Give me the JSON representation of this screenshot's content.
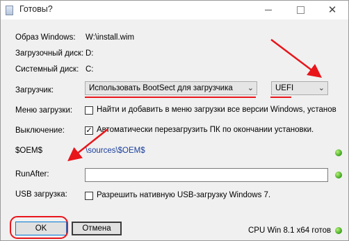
{
  "window": {
    "title": "Готовы?"
  },
  "titlebar": {
    "minimize": "—",
    "maximize": "☐",
    "close": "✕"
  },
  "fields": {
    "image_label": "Образ Windows:",
    "image_value": "W:\\install.wim",
    "boot_disk_label": "Загрузочный диск:",
    "boot_disk_value": "D:",
    "system_disk_label": "Системный диск:",
    "system_disk_value": "C:",
    "loader_label": "Загрузчик:",
    "loader_value": "Использовать BootSect для загрузчика",
    "firmware_value": "UEFI",
    "boot_menu_label": "Меню загрузки:",
    "boot_menu_checkbox": "Найти и добавить в меню загрузки все версии Windows, установ",
    "boot_menu_checked": false,
    "shutdown_label": "Выключение:",
    "shutdown_checkbox": "Автоматически перезагрузить ПК по окончании установки.",
    "shutdown_checked": true,
    "oem_label": "$OEM$",
    "oem_value": "\\sources\\$OEM$",
    "runafter_label": "RunAfter:",
    "runafter_value": "",
    "usb_label": "USB загрузка:",
    "usb_checkbox": "Разрешить нативную USB-загрузку Windows 7.",
    "usb_checked": false
  },
  "buttons": {
    "ok": "OK",
    "cancel": "Отмена"
  },
  "status": {
    "text": "CPU Win 8.1 x64 готов"
  },
  "colors": {
    "annotation": "#e8151b",
    "link": "#1a3e9c",
    "status_ok": "#3aa11c"
  },
  "icons": {
    "checkmark": "✓",
    "dropdown": "⌄"
  }
}
